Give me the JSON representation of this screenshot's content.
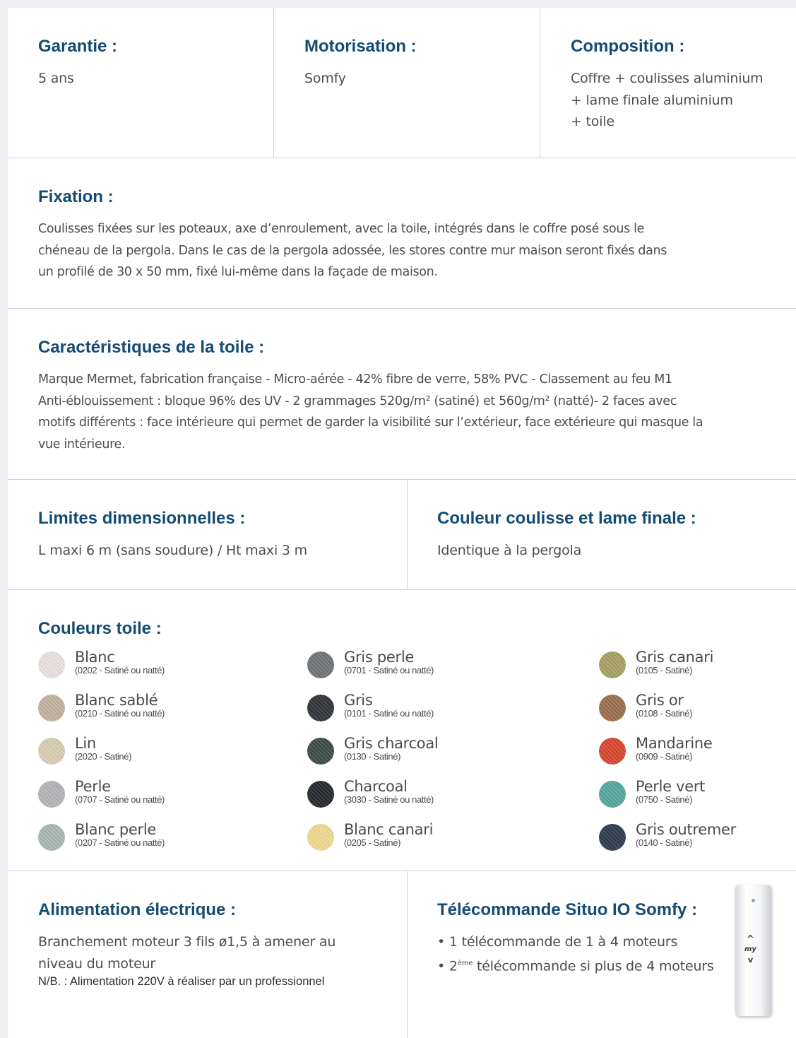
{
  "top": [
    {
      "title": "Garantie :",
      "lines": "5 ans"
    },
    {
      "title": "Motorisation :",
      "lines": "Somfy"
    },
    {
      "title": "Composition :",
      "lines": "Coffre + coulisses aluminium\n+ lame finale aluminium\n+ toile"
    }
  ],
  "fixation": {
    "title": "Fixation :",
    "text": "Coulisses fixées sur les poteaux, axe d’enroulement, avec la toile, intégrés dans le coffre posé sous le\nchéneau de la pergola. Dans le cas de la pergola adossée, les stores contre mur maison seront fixés dans\nun profilé de 30 x 50 mm, fixé lui-même dans la façade de maison."
  },
  "toile": {
    "title": "Caractéristiques de la toile :",
    "text": "Marque Mermet, fabrication française - Micro-aérée - 42% fibre de verre, 58% PVC - Classement au feu M1\nAnti-éblouissement : bloque 96% des UV - 2 grammages 520g/m² (satiné) et 560g/m² (natté)- 2 faces avec\nmotifs différents : face intérieure qui permet de garder la visibilité sur l’extérieur, face extérieure qui masque la\nvue intérieure."
  },
  "limites": {
    "title": "Limites dimensionnelles :",
    "text": "L maxi 6 m (sans soudure)  /  Ht maxi 3 m"
  },
  "couleur_coulisse": {
    "title": "Couleur coulisse et lame finale :",
    "text": "Identique à la pergola"
  },
  "couleurs": {
    "title": "Couleurs toile :",
    "columns": [
      [
        {
          "name": "Blanc",
          "code": "(0202 - Satiné ou natté)",
          "color": "#e8e2df"
        },
        {
          "name": "Blanc sablé",
          "code": "(0210 - Satiné ou natté)",
          "color": "#c2b19d"
        },
        {
          "name": "Lin",
          "code": "(2020 - Satiné)",
          "color": "#d9cdb2"
        },
        {
          "name": "Perle",
          "code": "(0707 - Satiné ou natté)",
          "color": "#b3b4b6"
        },
        {
          "name": "Blanc perle",
          "code": "(0207 - Satiné ou natté)",
          "color": "#a9b7b3"
        }
      ],
      [
        {
          "name": "Gris perle",
          "code": "(0701 - Satiné ou natté)",
          "color": "#6e7375"
        },
        {
          "name": "Gris",
          "code": "(0101 - Satiné ou natté)",
          "color": "#2f3338"
        },
        {
          "name": "Gris charcoal",
          "code": "(0130 - Satiné)",
          "color": "#3e4a48"
        },
        {
          "name": "Charcoal",
          "code": "(3030 - Satiné ou natté)",
          "color": "#23282d"
        },
        {
          "name": "Blanc canari",
          "code": "(0205 - Satiné)",
          "color": "#efd990"
        }
      ],
      [
        {
          "name": "Gris canari",
          "code": "(0105 - Satiné)",
          "color": "#a5a062"
        },
        {
          "name": "Gris or",
          "code": "(0108 - Satiné)",
          "color": "#9c6d4b"
        },
        {
          "name": "Mandarine",
          "code": "(0909 - Satiné)",
          "color": "#d7452e"
        },
        {
          "name": "Perle vert",
          "code": "(0750 - Satiné)",
          "color": "#55a59b"
        },
        {
          "name": "Gris outremer",
          "code": "(0140 - Satiné)",
          "color": "#2b3a4f"
        }
      ]
    ]
  },
  "alimentation": {
    "title": "Alimentation électrique :",
    "text": "Branchement moteur 3 fils ø1,5 à amener au\nniveau du moteur",
    "note": "N/B. : Alimentation 220V à réaliser par un professionnel"
  },
  "telecommande": {
    "title": "Télécommande Situo IO Somfy :",
    "bullet1": "• 1 télécommande de 1 à 4 moteurs",
    "bullet2_prefix": "• 2",
    "bullet2_sup": "ème",
    "bullet2_suffix": " télécommande si plus de 4 moteurs",
    "remote_up": "^",
    "remote_my": "my",
    "remote_down": "v"
  }
}
